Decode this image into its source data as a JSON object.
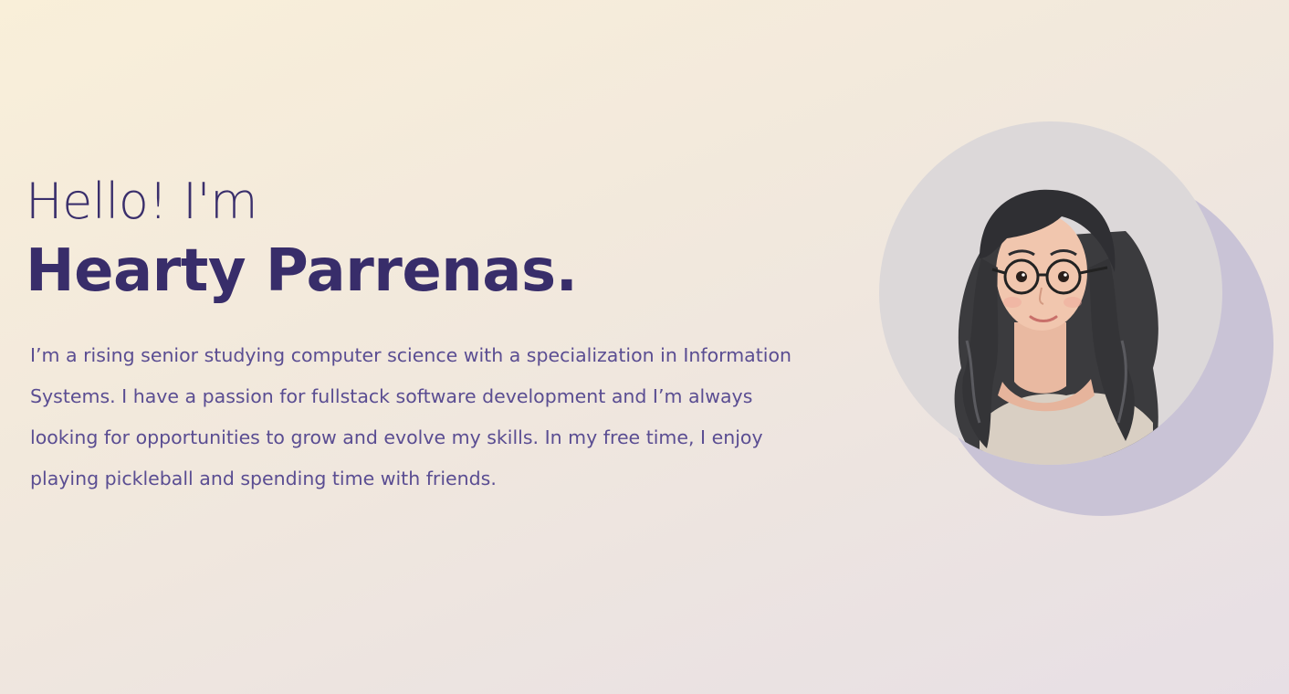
{
  "hero": {
    "greeting": "Hello! I'm",
    "name": "Hearty Parrenas.",
    "bio": "I’m a rising senior studying computer science with a specialization in Information Systems. I have a passion for fullstack software development and I’m always looking for opportunities to grow and evolve my skills. In my free time, I enjoy playing pickleball and spending time with friends."
  },
  "avatar": {
    "icon": "avatar-illustration"
  },
  "colors": {
    "heading": "#382d6a",
    "body_text": "#5a4d92",
    "avatar_bg": "#dcd8d9",
    "avatar_shadow": "#c9c3d6",
    "background_start": "#f9efd9",
    "background_end": "#e7dfe5"
  }
}
